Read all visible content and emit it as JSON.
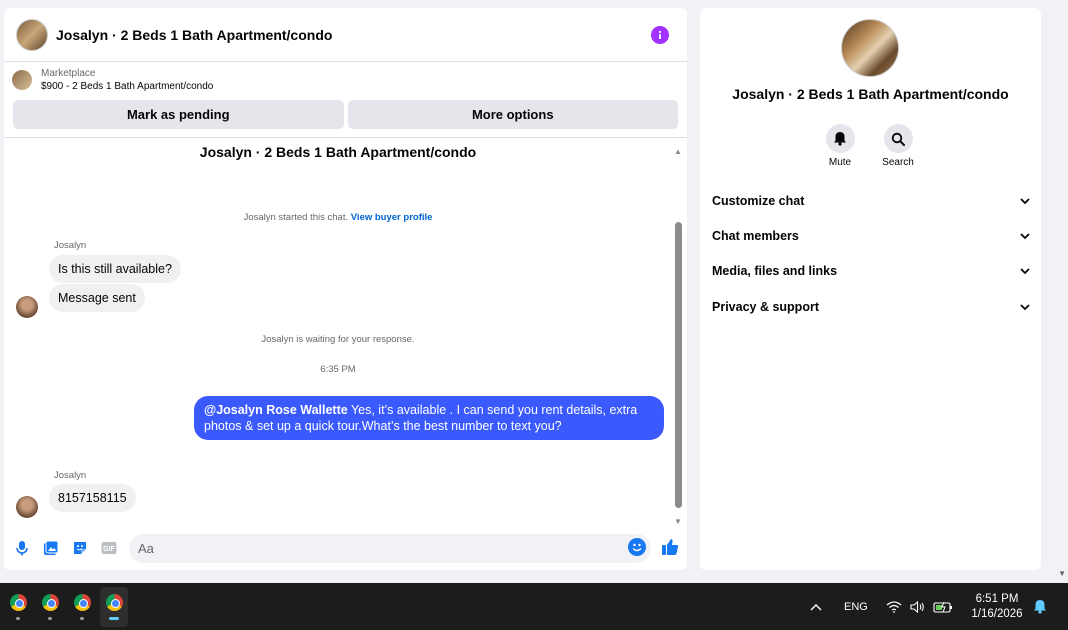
{
  "chat": {
    "header_title": "Josalyn · 2 Beds 1 Bath Apartment/condo",
    "marketplace_label": "Marketplace",
    "marketplace_item": "$900 - 2 Beds 1 Bath Apartment/condo",
    "mark_pending_label": "Mark as pending",
    "more_options_label": "More options",
    "conversation_title": "Josalyn · 2 Beds 1 Bath Apartment/condo",
    "started_text": "Josalyn started this chat.",
    "buyer_profile_link": "View buyer profile",
    "messages": [
      {
        "sender": "Josalyn",
        "text": "Is this still available?"
      },
      {
        "text": "Message sent"
      }
    ],
    "waiting_text": "Josalyn is waiting for your response.",
    "timestamp": "6:35 PM",
    "outgoing_mention": "@Josalyn Rose Wallette",
    "outgoing_text": " Yes, it’s available .  I can send you rent details, extra photos & set up a quick tour.What’s the best number to text you?",
    "reply_sender": "Josalyn",
    "reply_text": "8157158115",
    "composer_placeholder": "Aa"
  },
  "info": {
    "name": "Josalyn · 2 Beds 1 Bath Apartment/condo",
    "mute_label": "Mute",
    "search_label": "Search",
    "sections": [
      "Customize chat",
      "Chat members",
      "Media, files and links",
      "Privacy & support"
    ]
  },
  "taskbar": {
    "language": "ENG",
    "time": "6:51 PM",
    "date": "1/16/2026"
  },
  "colors": {
    "accent_purple": "#a033ff",
    "outgoing_bubble": "#3b5afe",
    "link_blue": "#0064d1",
    "messenger_blue": "#1877f2"
  }
}
